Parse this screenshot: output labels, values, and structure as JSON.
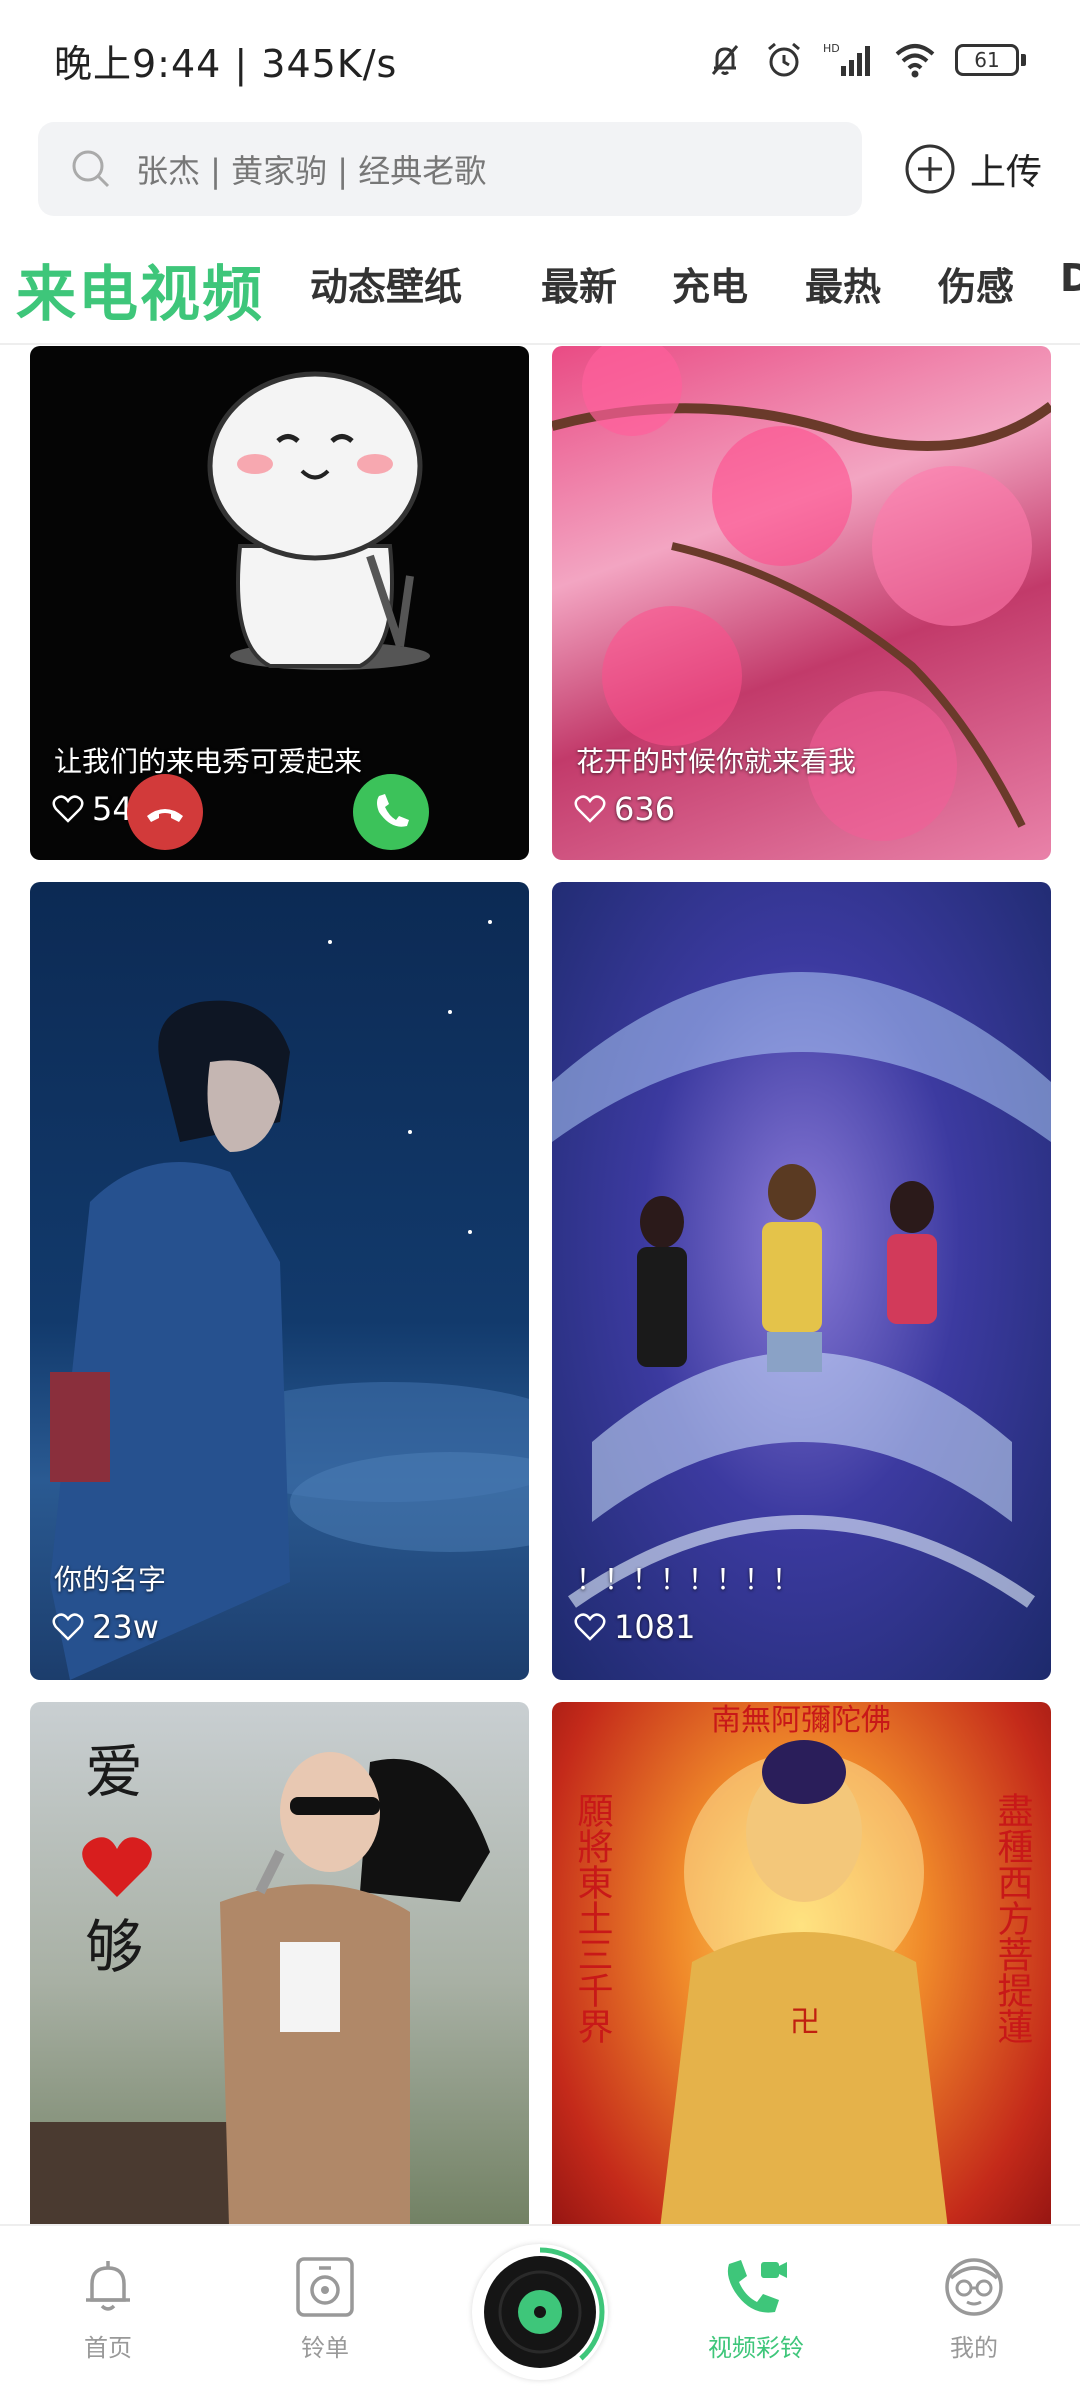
{
  "status_bar": {
    "time": "晚上9:44 | 345K/s",
    "battery": "61"
  },
  "search": {
    "placeholder": "张杰 | 黄家驹 | 经典老歌",
    "upload_label": "上传"
  },
  "tabs": {
    "active": "来电视频",
    "items": [
      "动态壁纸",
      "最新",
      "充电",
      "最热",
      "伤感",
      "D"
    ]
  },
  "cards": [
    {
      "title": "让我们的来电秀可爱起来",
      "likes": "5489"
    },
    {
      "title": "花开的时候你就来看我",
      "likes": "636"
    },
    {
      "title": "你的名字",
      "likes": "23w"
    },
    {
      "title": "！！！！！！！！",
      "likes": "1081"
    },
    {
      "overlay_text": [
        "爱",
        "够"
      ]
    },
    {
      "overlay_text": [
        "南無阿彌陀佛",
        "願將東土三千界",
        "盡種西方菩提蓮"
      ]
    }
  ],
  "bottom_nav": {
    "home": "首页",
    "ringlist": "铃单",
    "video_ring": "视频彩铃",
    "mine": "我的"
  },
  "colors": {
    "accent": "#3ec67a",
    "inactive": "#999999"
  }
}
